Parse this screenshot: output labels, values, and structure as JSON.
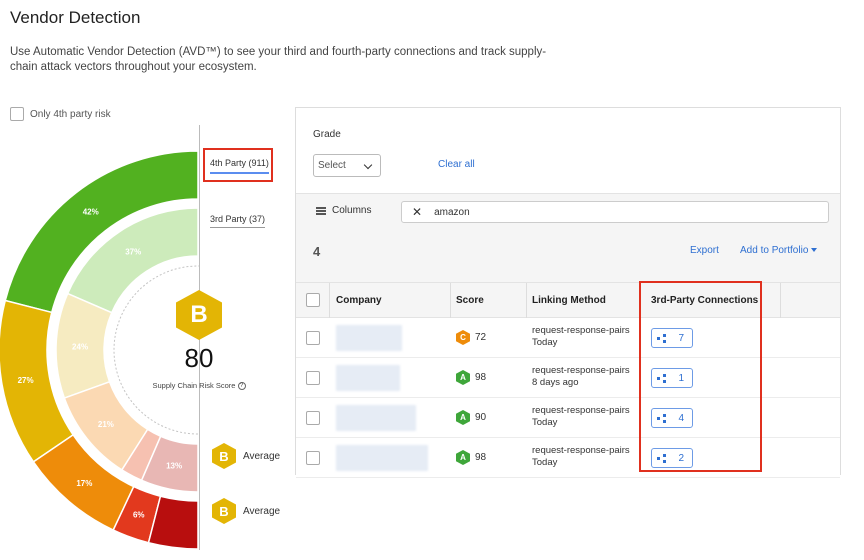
{
  "page": {
    "title": "Vendor Detection",
    "description": "Use Automatic Vendor Detection (AVD™) to see your third and fourth-party connections and track supply-chain attack vectors throughout your ecosystem."
  },
  "filter_toggle": {
    "label": "Only 4th party risk"
  },
  "party_tabs": {
    "fourth": "4th Party (911)",
    "third": "3rd Party (37)"
  },
  "summary": {
    "grade": "B",
    "score": "80",
    "score_label": "Supply Chain Risk Score",
    "info_glyph": "?",
    "fourth_party_grade": "B",
    "fourth_party_grade_label": "Average",
    "third_party_grade": "B",
    "third_party_grade_label": "Average"
  },
  "outer_ring": {
    "segments": [
      {
        "label": "42%",
        "value": 42,
        "color": "#52b120"
      },
      {
        "label": "27%",
        "value": 27,
        "color": "#e3b505"
      },
      {
        "label": "17%",
        "value": 17,
        "color": "#ee8c0a"
      },
      {
        "label": "6%",
        "value": 6,
        "color": "#e2391e"
      },
      {
        "label": "",
        "value": 8,
        "color": "#b80e0e"
      }
    ]
  },
  "inner_ring": {
    "segments": [
      {
        "label": "37%",
        "value": 37,
        "color": "#cdebbb"
      },
      {
        "label": "24%",
        "value": 24,
        "color": "#f6ebc1"
      },
      {
        "label": "21%",
        "value": 21,
        "color": "#fbd9b3"
      },
      {
        "label": "",
        "value": 5,
        "color": "#f6c1b1"
      },
      {
        "label": "13%",
        "value": 13,
        "color": "#e8b7b4"
      }
    ]
  },
  "filters": {
    "grade_label": "Grade",
    "grade_select": "Select",
    "clear_all": "Clear all",
    "columns_label": "Columns",
    "clear_search_glyph": "✕",
    "search_value": "amazon"
  },
  "results": {
    "count": "4",
    "export": "Export",
    "add_to_portfolio": "Add to Portfolio"
  },
  "table": {
    "headers": {
      "company": "Company",
      "score": "Score",
      "linking_method": "Linking Method",
      "connections": "3rd-Party Connections"
    },
    "rows": [
      {
        "grade": "C",
        "grade_color": "#ee8c0a",
        "score": "72",
        "method": "request-response-pairs",
        "when": "Today",
        "connections": "7"
      },
      {
        "grade": "A",
        "grade_color": "#3ea63a",
        "score": "98",
        "method": "request-response-pairs",
        "when": "8 days ago",
        "connections": "1"
      },
      {
        "grade": "A",
        "grade_color": "#3ea63a",
        "score": "90",
        "method": "request-response-pairs",
        "when": "Today",
        "connections": "4"
      },
      {
        "grade": "A",
        "grade_color": "#3ea63a",
        "score": "98",
        "method": "request-response-pairs",
        "when": "Today",
        "connections": "2"
      }
    ]
  }
}
